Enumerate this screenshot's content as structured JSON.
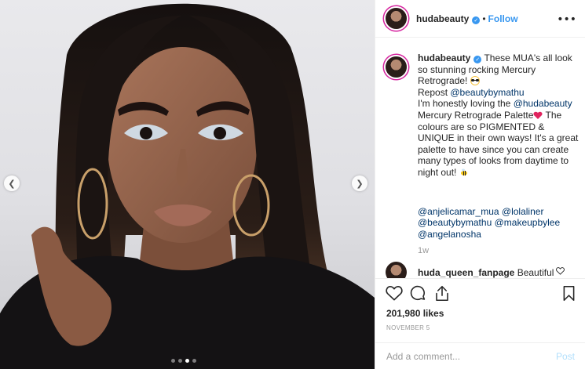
{
  "post": {
    "username": "hudabeauty",
    "follow_label": "Follow",
    "separator": "•",
    "more_label": "•••",
    "caption": {
      "username": "hudabeauty",
      "line1": " These MUA's all look so stunning rocking Mercury Retrograde! ",
      "repost_prefix": "Repost ",
      "repost_handle": "@beautybymathu",
      "line2": "I'm honestly loving the ",
      "mention_brand": "@hudabeauty",
      "line3": " Mercury Retrograde Palette",
      "line4": " The colours are so PIGMENTED & UNIQUE in their own ways! It's a great palette to have since you can create many types of looks from daytime to night out! ",
      "tags": [
        "@anjelicamar_mua",
        "@lolaliner",
        "@beautybymathu",
        "@makeupbylee",
        "@angelanosha"
      ]
    },
    "age": "1w",
    "reply": {
      "username": "huda_queen_fanpage",
      "text": "Beautiful"
    },
    "likes": "201,980 likes",
    "date": "NOVEMBER 5",
    "comment_placeholder": "Add a comment...",
    "post_label": "Post"
  },
  "media": {
    "dots": 4,
    "active_dot": 2
  },
  "icons": [
    "verified-icon",
    "more-icon",
    "heart-icon",
    "comment-icon",
    "share-icon",
    "bookmark-icon",
    "prev-arrow-icon",
    "next-arrow-icon"
  ],
  "colors": {
    "link": "#3897f0",
    "mention": "#003569",
    "muted": "#999999",
    "post_disabled": "#b2dffc"
  }
}
